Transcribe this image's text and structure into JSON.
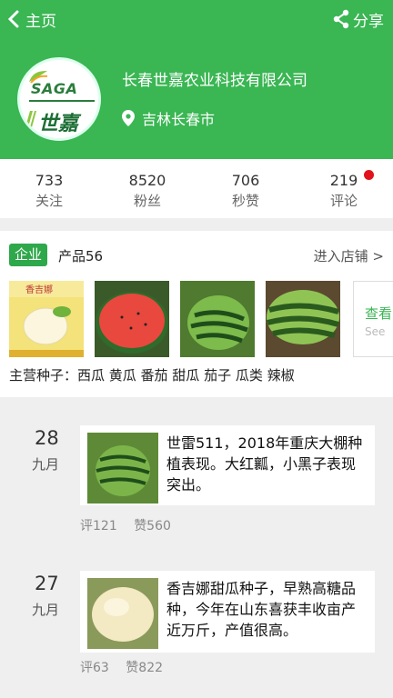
{
  "nav": {
    "back_label": "主页",
    "share_label": "分享"
  },
  "profile": {
    "logo_brand": "SAGA",
    "logo_cn": "世嘉",
    "company_name": "长春世嘉农业科技有限公司",
    "location": "吉林长春市"
  },
  "stats": [
    {
      "value": "733",
      "label": "关注"
    },
    {
      "value": "8520",
      "label": "粉丝"
    },
    {
      "value": "706",
      "label": "秒赞"
    },
    {
      "value": "219",
      "label": "评论"
    }
  ],
  "store": {
    "tag": "企业",
    "products": "产品56",
    "enter_label": "进入店铺 >",
    "packet_label": "香吉娜",
    "more_cn": "查看",
    "more_en": "See",
    "main_seeds": "主营种子：西瓜 黄瓜 番茄 甜瓜 茄子 瓜类 辣椒"
  },
  "posts": [
    {
      "day": "28",
      "month": "九月",
      "text": "世雷511，2018年重庆大棚种植表现。大红瓤，小黑子表现突出。",
      "comments": "评121",
      "likes": "赞560"
    },
    {
      "day": "27",
      "month": "九月",
      "text": "香吉娜甜瓜种子，早熟高糖品种，今年在山东喜获丰收亩产近万斤，产值很高。",
      "comments": "评63",
      "likes": "赞822"
    }
  ],
  "colors": {
    "brand_green": "#3ab653",
    "badge_red": "#e1121c"
  }
}
